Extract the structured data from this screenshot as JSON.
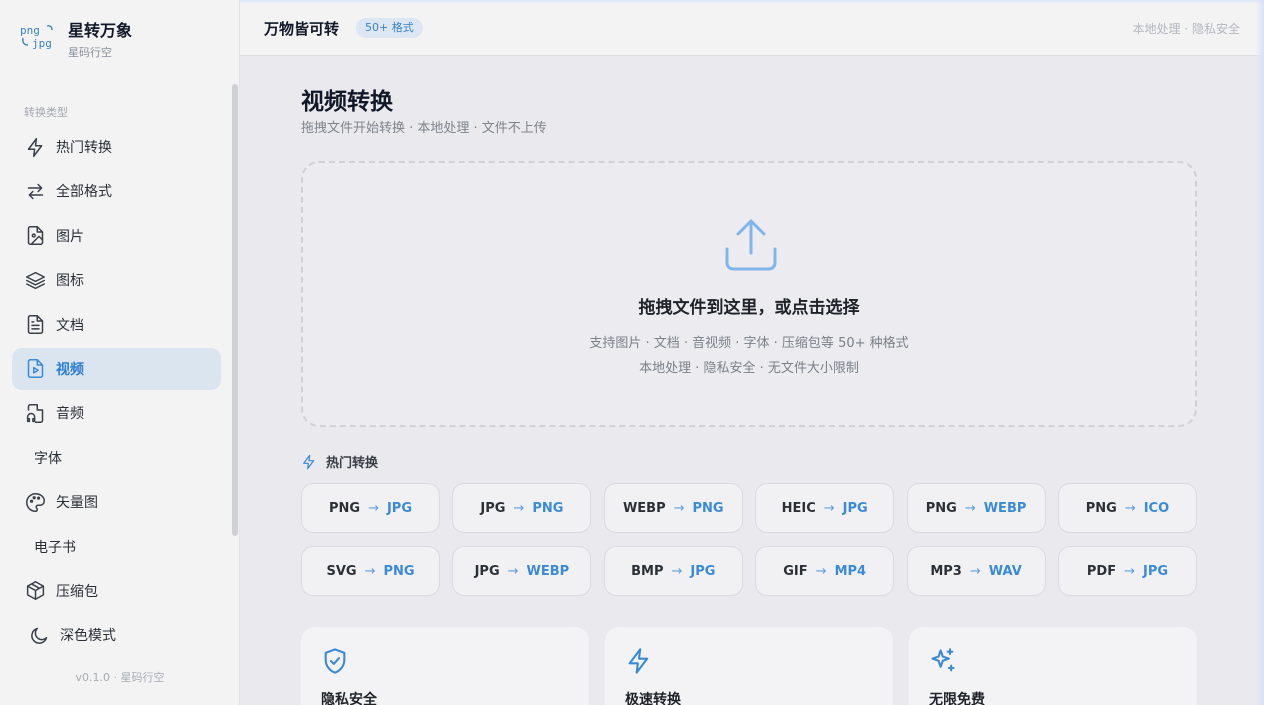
{
  "brand": {
    "logo_top": "png",
    "logo_bottom": "jpg",
    "name": "星转万象",
    "subtitle": "星码行空"
  },
  "sidebar": {
    "section_label": "转换类型",
    "items": [
      {
        "label": "热门转换",
        "icon": "zap-icon"
      },
      {
        "label": "全部格式",
        "icon": "swap-arrows-icon"
      },
      {
        "label": "图片",
        "icon": "image-file-icon"
      },
      {
        "label": "图标",
        "icon": "layers-icon"
      },
      {
        "label": "文档",
        "icon": "document-icon"
      },
      {
        "label": "视频",
        "icon": "video-file-icon",
        "active": true
      },
      {
        "label": "音频",
        "icon": "audio-file-icon"
      },
      {
        "label": "字体",
        "icon": ""
      },
      {
        "label": "矢量图",
        "icon": "palette-icon"
      },
      {
        "label": "电子书",
        "icon": ""
      },
      {
        "label": "压缩包",
        "icon": "package-icon"
      }
    ],
    "theme_toggle": "深色模式",
    "version": "v0.1.0 · 星码行空"
  },
  "header": {
    "title": "万物皆可转",
    "badge": "50+ 格式",
    "right_text": "本地处理 · 隐私安全"
  },
  "main": {
    "title": "视频转换",
    "subtitle": "拖拽文件开始转换 · 本地处理 · 文件不上传",
    "dropzone": {
      "icon": "upload-icon",
      "title": "拖拽文件到这里，或点击选择",
      "line1": "支持图片 · 文档 · 音视频 · 字体 · 压缩包等 50+ 种格式",
      "line2": "本地处理 · 隐私安全 · 无文件大小限制"
    },
    "hot_title": "热门转换",
    "conversions": [
      {
        "from": "PNG",
        "to": "JPG"
      },
      {
        "from": "JPG",
        "to": "PNG"
      },
      {
        "from": "WEBP",
        "to": "PNG"
      },
      {
        "from": "HEIC",
        "to": "JPG"
      },
      {
        "from": "PNG",
        "to": "WEBP"
      },
      {
        "from": "PNG",
        "to": "ICO"
      },
      {
        "from": "SVG",
        "to": "PNG"
      },
      {
        "from": "JPG",
        "to": "WEBP"
      },
      {
        "from": "BMP",
        "to": "JPG"
      },
      {
        "from": "GIF",
        "to": "MP4"
      },
      {
        "from": "MP3",
        "to": "WAV"
      },
      {
        "from": "PDF",
        "to": "JPG"
      }
    ],
    "arrow": "→",
    "features": [
      {
        "label": "隐私安全",
        "icon": "shield-check-icon"
      },
      {
        "label": "极速转换",
        "icon": "zap-icon"
      },
      {
        "label": "无限免费",
        "icon": "sparkles-icon"
      }
    ]
  },
  "colors": {
    "accent": "#3b8ad6",
    "active_bg": "#dbe5f0",
    "badge_bg": "#dce7f3"
  }
}
